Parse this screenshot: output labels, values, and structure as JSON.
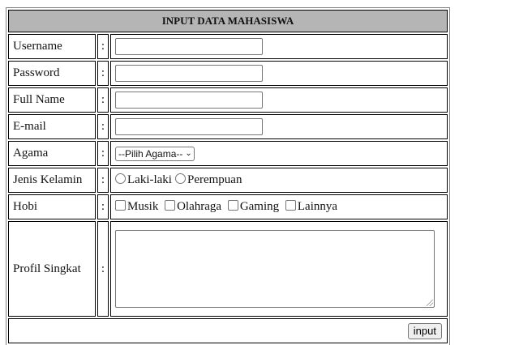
{
  "form": {
    "title": "INPUT DATA MAHASISWA",
    "colon": ":",
    "fields": {
      "username": {
        "label": "Username",
        "value": ""
      },
      "password": {
        "label": "Password",
        "value": ""
      },
      "fullname": {
        "label": "Full Name",
        "value": ""
      },
      "email": {
        "label": "E-mail",
        "value": ""
      }
    },
    "agama": {
      "label": "Agama",
      "selected": "--Pilih Agama--"
    },
    "gender": {
      "label": "Jenis Kelamin",
      "options": [
        "Laki-laki",
        "Perempuan"
      ]
    },
    "hobi": {
      "label": "Hobi",
      "options": [
        "Musik",
        "Olahraga",
        "Gaming",
        "Lainnya"
      ]
    },
    "profil": {
      "label": "Profil Singkat",
      "value": ""
    },
    "submit_label": "input"
  },
  "icons": {
    "select_chevron": "chevron-down-icon",
    "textarea_grip": "resize-grip-icon"
  }
}
